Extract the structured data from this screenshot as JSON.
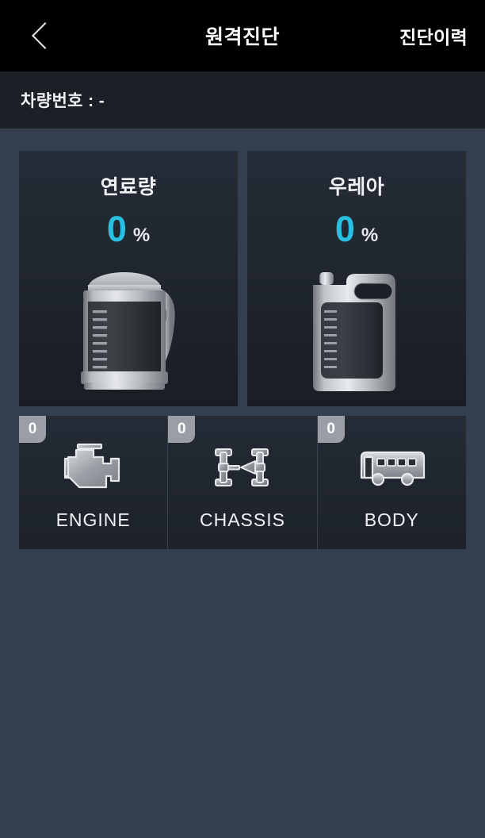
{
  "header": {
    "back_icon": "chevron-left-icon",
    "title": "원격진단",
    "action_label": "진단이력"
  },
  "vehicle": {
    "label": "차량번호 : -"
  },
  "gauges": [
    {
      "title": "연료량",
      "value": "0",
      "unit": "%",
      "icon": "fuel-canister-icon",
      "value_color": "#29bfe0"
    },
    {
      "title": "우레아",
      "value": "0",
      "unit": "%",
      "icon": "urea-jerrycan-icon",
      "value_color": "#29bfe0"
    }
  ],
  "diagnostics": [
    {
      "badge": "0",
      "label": "ENGINE",
      "icon": "engine-icon"
    },
    {
      "badge": "0",
      "label": "CHASSIS",
      "icon": "chassis-axle-icon"
    },
    {
      "badge": "0",
      "label": "BODY",
      "icon": "bus-body-icon"
    }
  ],
  "colors": {
    "page_background": "#333f4f",
    "header_background": "#000000",
    "vehicle_bar_background": "#1b1f26",
    "card_background": "#20262f",
    "badge_background": "#9a9ea6",
    "accent": "#29bfe0"
  }
}
